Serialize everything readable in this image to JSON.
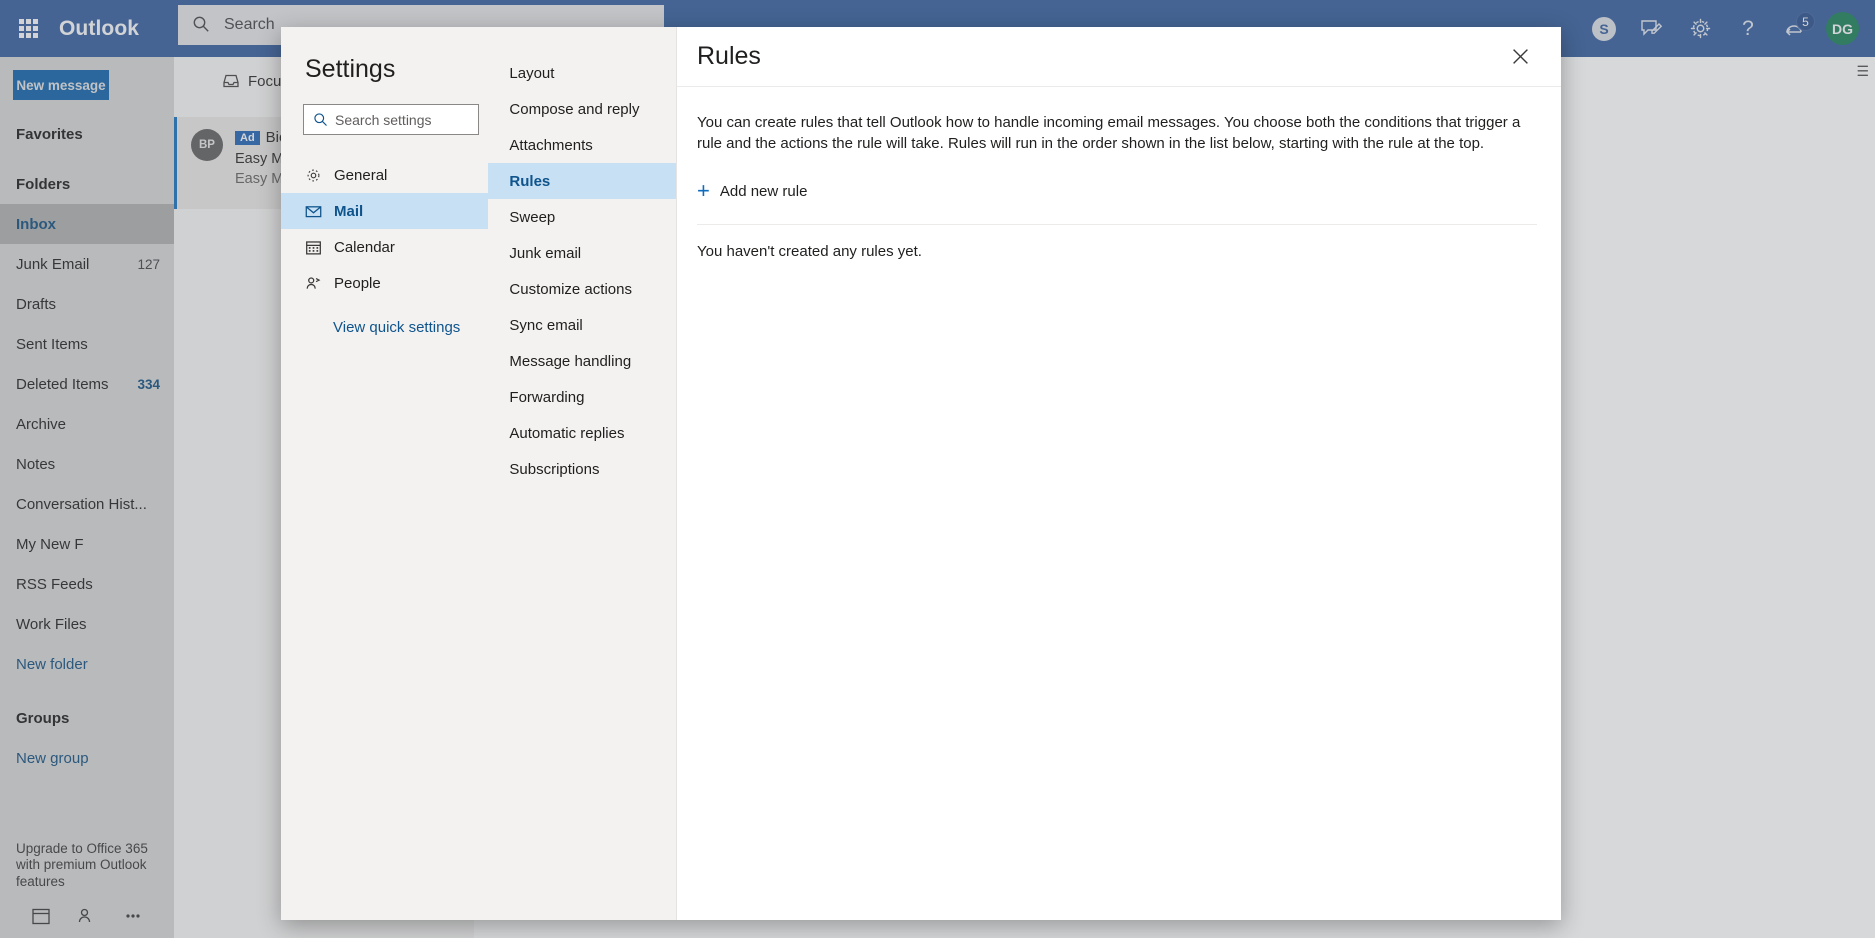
{
  "topbar": {
    "brand": "Outlook",
    "waffle_icon": "app-launcher-icon",
    "search_placeholder": "Search",
    "search_value": "",
    "search_icon": "search-icon",
    "icons": [
      {
        "name": "skype-icon",
        "glyph": "S"
      },
      {
        "name": "feedback-icon",
        "glyph": ""
      },
      {
        "name": "gear-icon",
        "glyph": ""
      },
      {
        "name": "help-icon",
        "glyph": "?"
      },
      {
        "name": "notifications-icon",
        "glyph": "",
        "badge": "5"
      }
    ],
    "avatar_initials": "DG"
  },
  "sidebar": {
    "new_message_label": "New message",
    "favorites_header": "Favorites",
    "folders_header": "Folders",
    "folders": [
      {
        "label": "Inbox",
        "count": "",
        "selected": true,
        "link": false
      },
      {
        "label": "Junk Email",
        "count": "127",
        "selected": false,
        "link": false
      },
      {
        "label": "Drafts",
        "count": "",
        "selected": false,
        "link": false
      },
      {
        "label": "Sent Items",
        "count": "",
        "selected": false,
        "link": false
      },
      {
        "label": "Deleted Items",
        "count": "334",
        "selected": false,
        "link": false
      },
      {
        "label": "Archive",
        "count": "",
        "selected": false,
        "link": false
      },
      {
        "label": "Notes",
        "count": "",
        "selected": false,
        "link": false
      },
      {
        "label": "Conversation Hist...",
        "count": "",
        "selected": false,
        "link": false
      },
      {
        "label": "My New F",
        "count": "",
        "selected": false,
        "link": false
      },
      {
        "label": "RSS Feeds",
        "count": "",
        "selected": false,
        "link": false
      },
      {
        "label": "Work Files",
        "count": "",
        "selected": false,
        "link": false
      },
      {
        "label": "New folder",
        "count": "",
        "selected": false,
        "link": true
      }
    ],
    "groups_header": "Groups",
    "new_group_label": "New group",
    "upsell_text": "Upgrade to Office 365 with premium Outlook features",
    "bottom_nav": [
      {
        "name": "calendar-icon"
      },
      {
        "name": "people-icon"
      },
      {
        "name": "more-apps-icon"
      }
    ]
  },
  "maillist": {
    "focused_tab": "Focu",
    "focused_icon": "inbox-icon",
    "items": [
      {
        "avatar": "BP",
        "badge": "Ad",
        "sender": "BioL",
        "subject": "Easy Mo",
        "preview": "Easy Mo"
      }
    ]
  },
  "settings_dialog": {
    "title": "Settings",
    "search_placeholder": "Search settings",
    "search_value": "",
    "search_icon": "search-icon",
    "categories": [
      {
        "label": "General",
        "icon": "gear-icon",
        "selected": false
      },
      {
        "label": "Mail",
        "icon": "envelope-icon",
        "selected": true
      },
      {
        "label": "Calendar",
        "icon": "calendar-icon",
        "selected": false
      },
      {
        "label": "People",
        "icon": "person-icon",
        "selected": false
      }
    ],
    "view_quick_settings": "View quick settings",
    "subitems": [
      {
        "label": "Layout",
        "selected": false
      },
      {
        "label": "Compose and reply",
        "selected": false
      },
      {
        "label": "Attachments",
        "selected": false
      },
      {
        "label": "Rules",
        "selected": true
      },
      {
        "label": "Sweep",
        "selected": false
      },
      {
        "label": "Junk email",
        "selected": false
      },
      {
        "label": "Customize actions",
        "selected": false
      },
      {
        "label": "Sync email",
        "selected": false
      },
      {
        "label": "Message handling",
        "selected": false
      },
      {
        "label": "Forwarding",
        "selected": false
      },
      {
        "label": "Automatic replies",
        "selected": false
      },
      {
        "label": "Subscriptions",
        "selected": false
      }
    ],
    "pane": {
      "title": "Rules",
      "close_icon": "close-icon",
      "description": "You can create rules that tell Outlook how to handle incoming email messages. You choose both the conditions that trigger a rule and the actions the rule will take. Rules will run in the order shown in the list below, starting with the rule at the top.",
      "add_new_rule_label": "Add new rule",
      "add_icon": "plus-icon",
      "empty_message": "You haven't created any rules yet."
    }
  },
  "colors": {
    "brand_blue": "#2b579a",
    "accent_blue": "#0f6cbd",
    "link_blue": "#0f548c",
    "selection_blue": "#c7e0f4",
    "panel_grey": "#f3f2f1",
    "avatar_green": "#0f7b50"
  }
}
